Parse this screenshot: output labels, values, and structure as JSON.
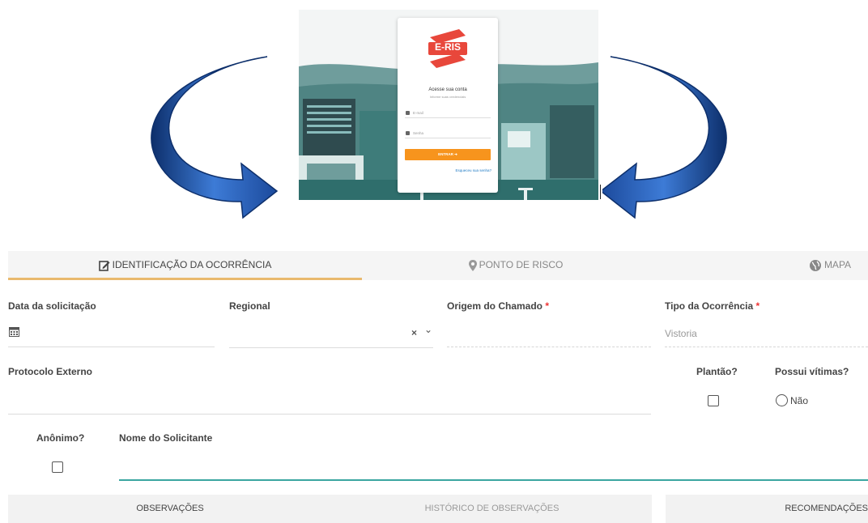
{
  "login_preview": {
    "logo_text": "E-RIS",
    "title": "Acesse sua conta",
    "subtitle": "Informe suas credenciais",
    "email_placeholder": "E-mail",
    "password_placeholder": "Senha",
    "submit_label": "ENTRAR",
    "forgot_link": "Esqueceu sua senha?"
  },
  "tabs": [
    {
      "label": "IDENTIFICAÇÃO DA OCORRÊNCIA",
      "icon": "edit-icon",
      "active": true
    },
    {
      "label": "PONTO DE RISCO",
      "icon": "map-pin-icon",
      "active": false
    },
    {
      "label": "MAPA",
      "icon": "globe-icon",
      "active": false
    }
  ],
  "form": {
    "data_solicitacao": {
      "label": "Data da solicitação",
      "icon": "calendar-icon",
      "value": ""
    },
    "regional": {
      "label": "Regional",
      "value": "",
      "clear": "×",
      "chevron": "⌄"
    },
    "origem": {
      "label": "Origem do Chamado",
      "required": "*",
      "value": ""
    },
    "tipo": {
      "label": "Tipo da Ocorrência",
      "required": "*",
      "value": "Vistoria"
    },
    "protocolo": {
      "label": "Protocolo Externo",
      "value": ""
    },
    "plantao": {
      "label": "Plantão?",
      "checked": false
    },
    "vitimas": {
      "label": "Possui vítimas?",
      "option": "Não"
    },
    "anonimo": {
      "label": "Anônimo?",
      "checked": false
    },
    "nome": {
      "label": "Nome do Solicitante",
      "value": ""
    }
  },
  "bottom_tabs": [
    {
      "label": "OBSERVAÇÕES",
      "active": true
    },
    {
      "label": "HISTÓRICO DE OBSERVAÇÕES",
      "active": false
    },
    {
      "label": "RECOMENDAÇÕES",
      "active": true
    }
  ],
  "colors": {
    "arrow_blue": "#2e5fb0",
    "accent_orange": "#f7941d",
    "active_underline": "#e9b96e",
    "field_active": "#3aa6a0",
    "logo_red": "#e8473b"
  }
}
